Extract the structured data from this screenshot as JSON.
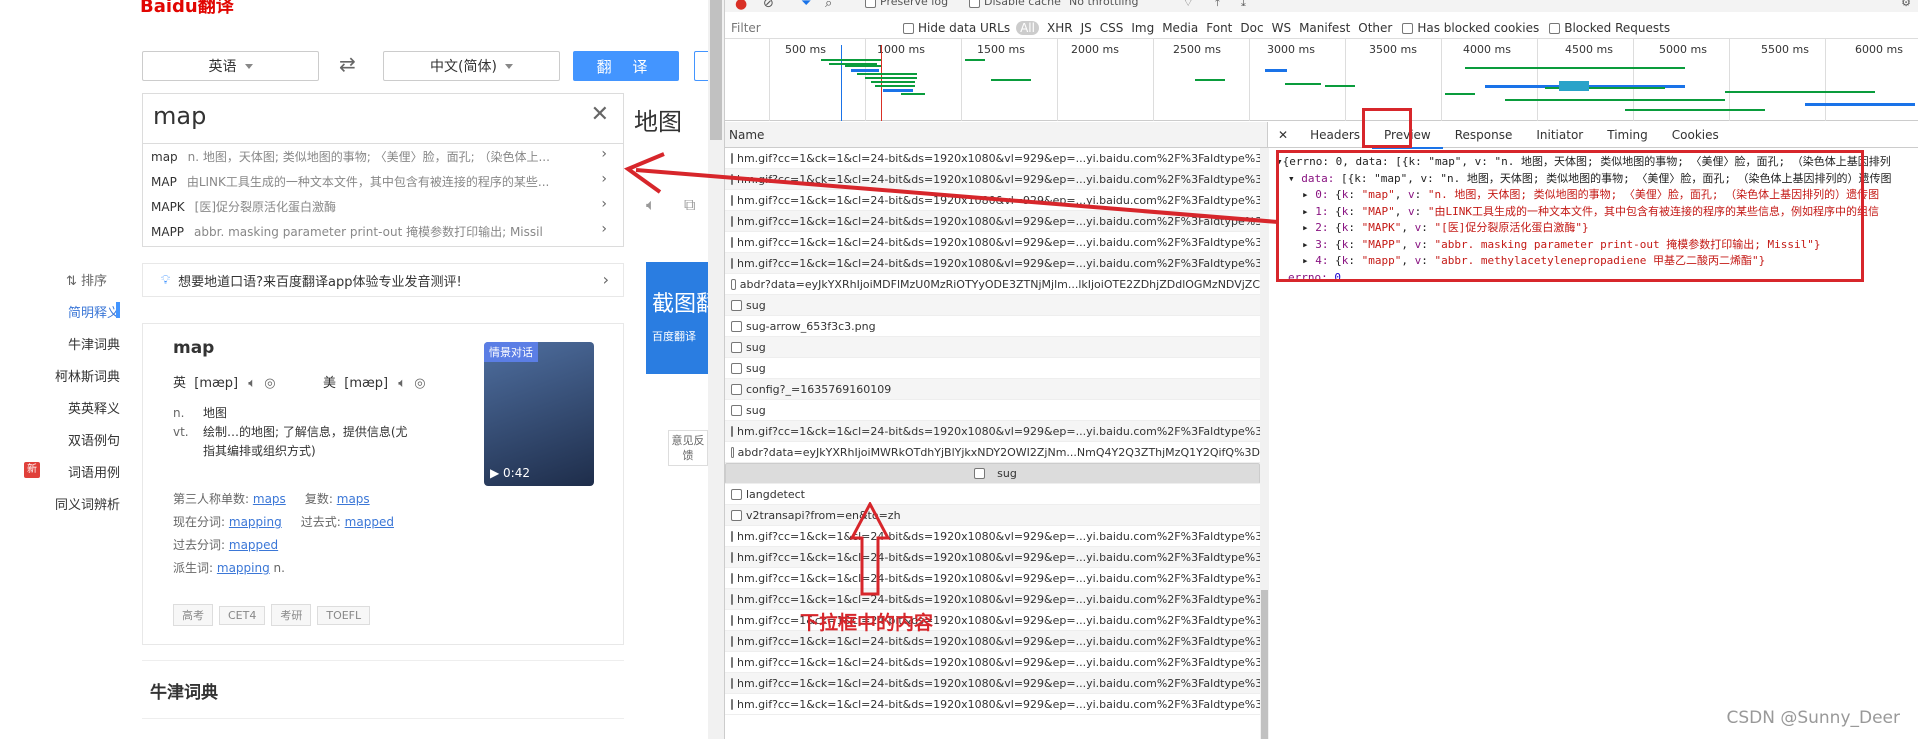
{
  "baidu": {
    "logo": "Baidu翻译",
    "from_lang": "英语",
    "swap_icon": "swap-arrows-icon",
    "to_lang": "中文(简体)",
    "translate_btn": "翻 译",
    "query": "map",
    "result_title": "地图",
    "suggestions": [
      {
        "word": "map",
        "def": "n. 地图，天体图; 类似地图的事物; 〈美俚〉脸，面孔; （染色体上..."
      },
      {
        "word": "MAP",
        "def": "由LINK工具生成的一种文本文件，其中包含有被连接的程序的某些..."
      },
      {
        "word": "MAPK",
        "def": "[医]促分裂原活化蛋白激酶"
      },
      {
        "word": "MAPP",
        "def": "abbr. masking parameter print-out 掩模参数打印输出; Missil"
      }
    ],
    "sort_label": "排序",
    "nav": [
      "简明释义",
      "牛津词典",
      "柯林斯词典",
      "英英释义",
      "双语例句",
      "词语用例",
      "同义词辨析"
    ],
    "nav_new_badge": "新",
    "promo": "想要地道口语?来百度翻译app体验专业发音测评!",
    "ad_text": "截图翻",
    "ad_sub": "百度翻译",
    "feedback": "意见反馈",
    "card": {
      "word": "map",
      "uk_label": "英",
      "uk_phon": "[mæp]",
      "us_label": "美",
      "us_phon": "[mæp]",
      "pos1": "n.",
      "def1": "地图",
      "pos2": "vt.",
      "def2a": "绘制…的地图; 了解信息，提供信息(尤",
      "def2b": "指其编排或组织方式)",
      "forms": {
        "third_label": "第三人称单数:",
        "third": "maps",
        "plural_label": "复数:",
        "plural": "maps",
        "present_label": "现在分词:",
        "present": "mapping",
        "past_label": "过去式:",
        "past": "mapped",
        "pp_label": "过去分词:",
        "pp": "mapped",
        "deriv_label": "派生词:",
        "deriv": "mapping",
        "deriv_pos": "n."
      },
      "tags": [
        "高考",
        "CET4",
        "考研",
        "TOEFL"
      ],
      "video_label": "情景对话",
      "video_time": "0:42"
    },
    "oxford_title": "牛津词典"
  },
  "devtools": {
    "toolbar_items": [
      "Preserve log",
      "Disable cache",
      "No throttling"
    ],
    "filter_placeholder": "Filter",
    "hide_data_urls": "Hide data URLs",
    "type_filters": [
      "All",
      "XHR",
      "JS",
      "CSS",
      "Img",
      "Media",
      "Font",
      "Doc",
      "WS",
      "Manifest",
      "Other"
    ],
    "blocked_cookies": "Has blocked cookies",
    "blocked_requests": "Blocked Requests",
    "ticks": [
      "500 ms",
      "1000 ms",
      "1500 ms",
      "2000 ms",
      "2500 ms",
      "3000 ms",
      "3500 ms",
      "4000 ms",
      "4500 ms",
      "5000 ms",
      "5500 ms",
      "6000 ms"
    ],
    "name_header": "Name",
    "requests": [
      "hm.gif?cc=1&ck=1&cl=24-bit&ds=1920x1080&vl=929&ep=...yi.baidu.com%2F%3Faldtype%3D",
      "hm.gif?cc=1&ck=1&cl=24-bit&ds=1920x1080&vl=929&ep=...yi.baidu.com%2F%3Faldtype%3D",
      "hm.gif?cc=1&ck=1&cl=24-bit&ds=1920x1080&vl=929&ep=...yi.baidu.com%2F%3Faldtype%3D",
      "hm.gif?cc=1&ck=1&cl=24-bit&ds=1920x1080&vl=929&ep=...yi.baidu.com%2F%3Faldtype%3D",
      "hm.gif?cc=1&ck=1&cl=24-bit&ds=1920x1080&vl=929&ep=...yi.baidu.com%2F%3Faldtype%3D",
      "hm.gif?cc=1&ck=1&cl=24-bit&ds=1920x1080&vl=929&ep=...yi.baidu.com%2F%3Faldtype%3D",
      "abdr?data=eyJkYXRhIjoiMDFlMzU0MzRiOTYyODE3ZTNjMjlm...lkIjoiOTE2ZDhjZDdlOGMzNDVjZC",
      "sug",
      "sug-arrow_653f3c3.png",
      "sug",
      "sug",
      "config?_=1635769160109",
      "sug",
      "hm.gif?cc=1&ck=1&cl=24-bit&ds=1920x1080&vl=929&ep=...yi.baidu.com%2F%3Faldtype%3D",
      "abdr?data=eyJkYXRhIjoiMWRkOTdhYjBlYjkxNDY2OWI2ZjNm...NmQ4Y2Q3ZThjMzQ1Y2QifQ%3D",
      "sug",
      "langdetect",
      "v2transapi?from=en&to=zh",
      "hm.gif?cc=1&ck=1&cl=24-bit&ds=1920x1080&vl=929&ep=...yi.baidu.com%2F%3Faldtype%3D",
      "hm.gif?cc=1&ck=1&cl=24-bit&ds=1920x1080&vl=929&ep=...yi.baidu.com%2F%3Faldtype%3D",
      "hm.gif?cc=1&ck=1&cl=24-bit&ds=1920x1080&vl=929&ep=...yi.baidu.com%2F%3Faldtype%3D",
      "hm.gif?cc=1&ck=1&cl=24-bit&ds=1920x1080&vl=929&ep=...yi.baidu.com%2F%3Faldtype%3D",
      "hm.gif?cc=1&ck=1&cl=24-bit&ds=1920x1080&vl=929&ep=...yi.baidu.com%2F%3Faldtype%3D",
      "hm.gif?cc=1&ck=1&cl=24-bit&ds=1920x1080&vl=929&ep=...yi.baidu.com%2F%3Faldtype%3D",
      "hm.gif?cc=1&ck=1&cl=24-bit&ds=1920x1080&vl=929&ep=...yi.baidu.com%2F%3Faldtype%3D",
      "hm.gif?cc=1&ck=1&cl=24-bit&ds=1920x1080&vl=929&ep=...yi.baidu.com%2F%3Faldtype%3D",
      "hm.gif?cc=1&ck=1&cl=24-bit&ds=1920x1080&vl=929&ep=...yi.baidu.com%2F%3Faldtype%3D"
    ],
    "tabs": [
      "Headers",
      "Preview",
      "Response",
      "Initiator",
      "Timing",
      "Cookies"
    ],
    "preview": {
      "line0": "{errno: 0, data: [{k: \"map\", v: \"n. 地图，天体图; 类似地图的事物; 〈美俚〉脸，面孔; （染色体上基因排列",
      "data_key": "data:",
      "data_val": "[{k: \"map\", v: \"n. 地图，天体图; 类似地图的事物; 〈美俚〉脸，面孔; （染色体上基因排列的）遗传图",
      "items": [
        {
          "idx": "0:",
          "k": "\"map\"",
          "v": "\"n. 地图，天体图; 类似地图的事物; 〈美俚〉脸，面孔; （染色体上基因排列的）遗传图"
        },
        {
          "idx": "1:",
          "k": "\"MAP\"",
          "v": "\"由LINK工具生成的一种文本文件，其中包含有被连接的程序的某些信息，例如程序中的组信"
        },
        {
          "idx": "2:",
          "k": "\"MAPK\"",
          "v": "\"[医]促分裂原活化蛋白激酶\"}"
        },
        {
          "idx": "3:",
          "k": "\"MAPP\"",
          "v": "\"abbr. masking parameter print-out 掩模参数打印输出; Missil\"}"
        },
        {
          "idx": "4:",
          "k": "\"mapp\"",
          "v": "\"abbr. methylacetylenepropadiene 甲基乙二酸丙二烯酯\"}"
        }
      ],
      "errno_key": "errno:",
      "errno_val": "0"
    }
  },
  "annotation": "下拉框中的内容",
  "watermark": "CSDN @Sunny_Deer",
  "colors": {
    "accent": "#4395ff",
    "annot_red": "#d7262b",
    "devtools_blue": "#1a73e8"
  }
}
